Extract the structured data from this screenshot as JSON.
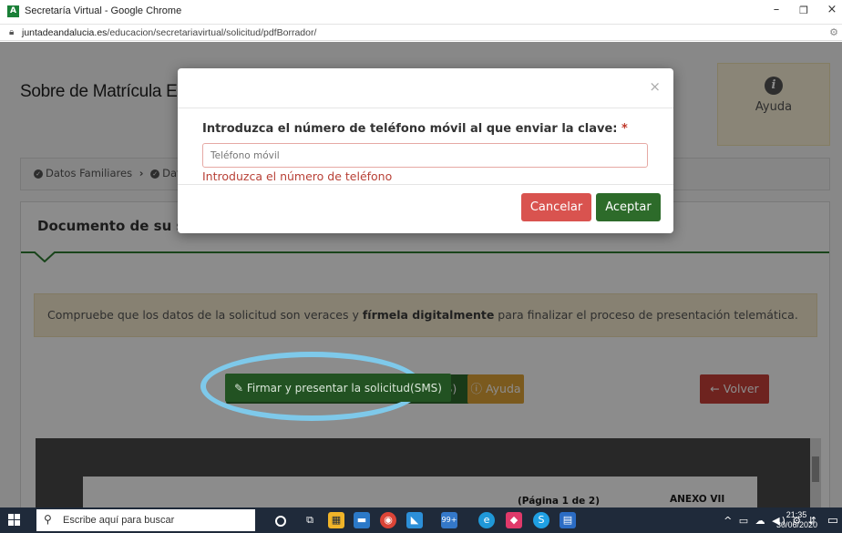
{
  "browser": {
    "window_title": "Secretaría Virtual - Google Chrome",
    "url_host": "juntadeandalucia.es",
    "url_path": "/educacion/secretariavirtual/solicitud/pdfBorrador/",
    "minimize": "–",
    "restore": "❐",
    "close": "×"
  },
  "page": {
    "title": "Sobre de Matrícula Edu",
    "help_label": "Ayuda",
    "help_icon_glyph": "i",
    "breadcrumb": [
      {
        "label": "Datos Familiares"
      },
      {
        "label": "Dat"
      }
    ],
    "card_title": "Documento de su soli",
    "alert_pre": "Compruebe que los datos de la solicitud son veraces y ",
    "alert_bold": "fírmela digitalmente",
    "alert_post": " para finalizar el proceso de presentación telemática.",
    "sign_button": "Firmar y presentar la solicitud(SMS)",
    "help_button": "Ayuda",
    "back_button": "Volver",
    "pdf_page_label": "(Página 1 de 2)",
    "pdf_annex": "ANEXO VII",
    "highlight_color": "#7ec9ea"
  },
  "modal": {
    "label": "Introduzca el número de teléfono móvil al que enviar la clave:",
    "required_mark": "*",
    "placeholder": "Teléfono móvil",
    "error": "Introduzca el número de teléfono",
    "cancel": "Cancelar",
    "accept": "Aceptar",
    "close_glyph": "×"
  },
  "taskbar": {
    "search_placeholder": "Escribe aquí para buscar",
    "time": "21:35",
    "date": "30/06/2020",
    "badge": "99+"
  },
  "colors": {
    "accent_green": "#2e6b2c",
    "danger_red": "#d9534f",
    "warning_orange": "#e1a437"
  }
}
